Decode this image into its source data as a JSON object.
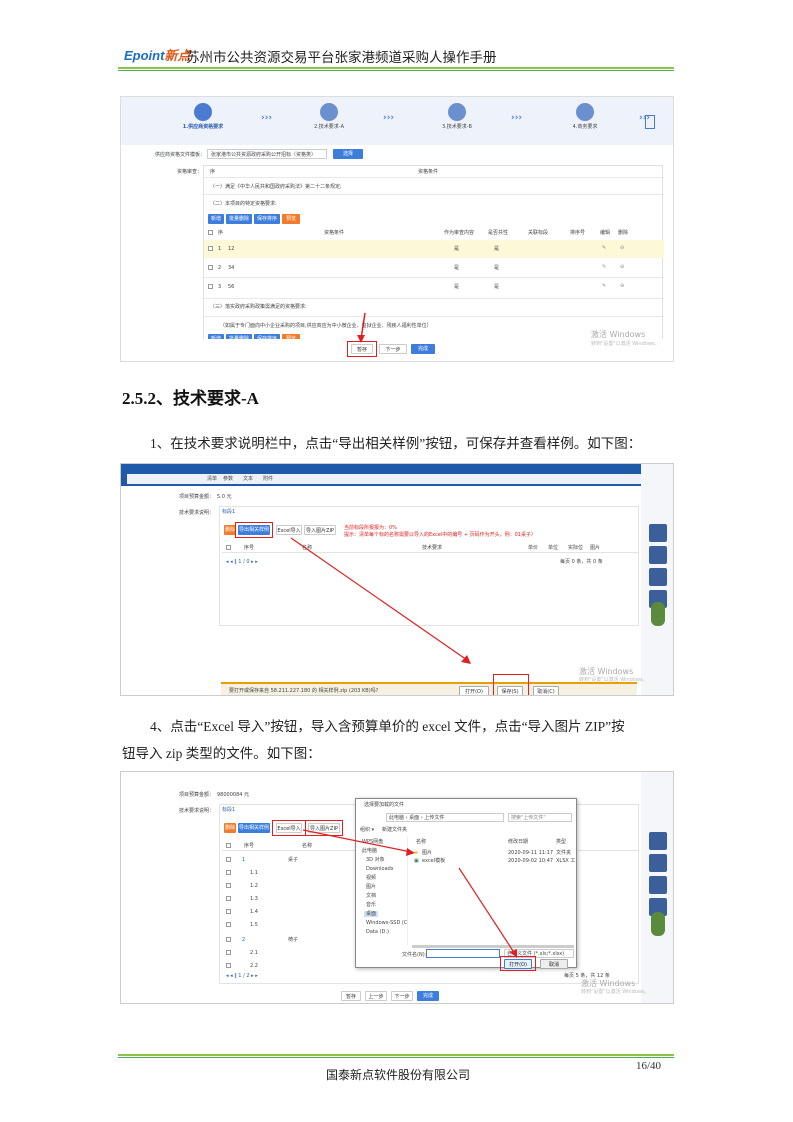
{
  "header": {
    "logo_en": "Epoint",
    "logo_cn": "新点",
    "title": "苏州市公共资源交易平台张家港频道采购人操作手册"
  },
  "shot1": {
    "steps": [
      {
        "label": "1.供应商资格要求"
      },
      {
        "label": "2.技术要求-A"
      },
      {
        "label": "3.技术要求-B"
      },
      {
        "label": "4.商务要求"
      }
    ],
    "chevron": "›››",
    "template_label": "供应商资格文件模板：",
    "template_value": "张家港市公共资源政府采购公开招标（资格类）",
    "template_btn": "选择",
    "qual_label": "资格审查：",
    "col_seq": "序",
    "col_cond": "资格条件",
    "clause1": "（一）满足《中华人民共和国政府采购法》第二十二条规定;",
    "clause2": "（二）本项目的特定资格要求:",
    "toolbar": [
      "新增",
      "批量删除",
      "保存排序",
      "预览"
    ],
    "table_headers": [
      "序",
      "资格条件",
      "作为审查内容",
      "是否共性",
      "关联标段",
      "排序号",
      "编辑",
      "删除"
    ],
    "rows": [
      {
        "seq": "1",
        "cond": "12",
        "review": "是",
        "common": "是"
      },
      {
        "seq": "2",
        "cond": "34",
        "review": "是",
        "common": "是"
      },
      {
        "seq": "3",
        "cond": "56",
        "review": "是",
        "common": "是"
      }
    ],
    "clause3": "（三）落实政府采购政策需满足的资格要求:",
    "clause3_note": "（如属于专门面向中小企业采购的项目,供应商应为中小微企业、监狱企业、残疾人福利性单位）",
    "bottom_buttons": [
      "暂存",
      "下一步",
      "完成"
    ],
    "watermark": "激活 Windows",
    "watermark_sub": "转到\"设置\"以激活 Windows。"
  },
  "section_heading": "2.5.2、技术要求-A",
  "para1": "1、在技术要求说明栏中，点击“导出相关样例”按钮，可保存并查看样例。如下图：",
  "shot2": {
    "top_tabs": [
      "清单",
      "参数",
      "文本",
      "附件"
    ],
    "budget_label": "项目预算金额：",
    "budget_value": "5.0 元",
    "req_label": "技术要求说明：",
    "tab": "标段1",
    "toolbar": [
      "删除",
      "导出相关样例",
      "Excel导入",
      "导入图片ZIP"
    ],
    "note1": "当前标段所报报为：0%",
    "note2": "提示：清单每个标的名称需要以导入的Excel中的编号 + 页码作为开头，例：01桌子）",
    "table_headers": [
      "序号",
      "名称",
      "技术要求",
      "单价",
      "单位",
      "实际位",
      "图片"
    ],
    "pager": "1 / 0",
    "pager_right": "每页 0 条，共 0 条",
    "download_text": "要打开或保存来自 58.211.227.180 的 相关样例.zip (203 KB)吗?",
    "dl_buttons": [
      "打开(O)",
      "保存(S)",
      "取消(C)"
    ],
    "watermark": "激活 Windows",
    "watermark_sub": "转到\"设置\"以激活 Windows。"
  },
  "para2_line1": "4、点击“Excel 导入”按钮，导入含预算单价的 excel 文件，点击“导入图片 ZIP”按",
  "para2_line2": "钮导入 zip 类型的文件。如下图：",
  "shot3": {
    "budget_label": "项目预算金额：",
    "budget_value": "98000084 元",
    "req_label": "技术要求说明：",
    "tab": "标段1",
    "toolbar": [
      "删除",
      "导出相关样例",
      "Excel导入",
      "导入图片ZIP"
    ],
    "table_headers": [
      "序号",
      "名称"
    ],
    "rows": [
      {
        "seq": "1",
        "name": "桌子"
      },
      {
        "seq": "1.1",
        "name": ""
      },
      {
        "seq": "1.2",
        "name": ""
      },
      {
        "seq": "1.3",
        "name": ""
      },
      {
        "seq": "1.4",
        "name": ""
      },
      {
        "seq": "1.5",
        "name": ""
      },
      {
        "seq": "2",
        "name": "椅子"
      },
      {
        "seq": "2.1",
        "name": ""
      },
      {
        "seq": "2.2",
        "name": ""
      }
    ],
    "pager": "1 / 2",
    "pager_right": "每页 5 条，共 12 条",
    "dialog": {
      "title": "选择要加载的文件",
      "path": "此电脑 › 桌面 › 上传文件",
      "search": "搜索\"上传文件\"",
      "organize": "组织 ▾",
      "new_folder": "新建文件夹",
      "col_name": "名称",
      "col_date": "修改日期",
      "col_type": "类型",
      "files": [
        {
          "name": "图片",
          "date": "2020-09-11 11:17",
          "type": "文件夹"
        },
        {
          "name": "excel模板",
          "date": "2020-09-02 10:47",
          "type": "XLSX 工"
        }
      ],
      "tree": [
        "WPS网盘",
        "此电脑",
        "3D 对象",
        "Downloads",
        "视频",
        "图片",
        "文档",
        "音乐",
        "桌面",
        "Windows-SSD (C",
        "Data (D:)"
      ],
      "filename_label": "文件名(N):",
      "filter": "自定义文件 (*.xls;*.xlsx)",
      "open_btn": "打开(O)",
      "cancel_btn": "取消"
    },
    "bottom_buttons": [
      "暂存",
      "上一步",
      "下一步",
      "完成"
    ],
    "watermark": "激活 Windows",
    "watermark_sub": "转到\"设置\"以激活 Windows。"
  },
  "footer": {
    "page": "16/40",
    "company": "国泰新点软件股份有限公司"
  }
}
